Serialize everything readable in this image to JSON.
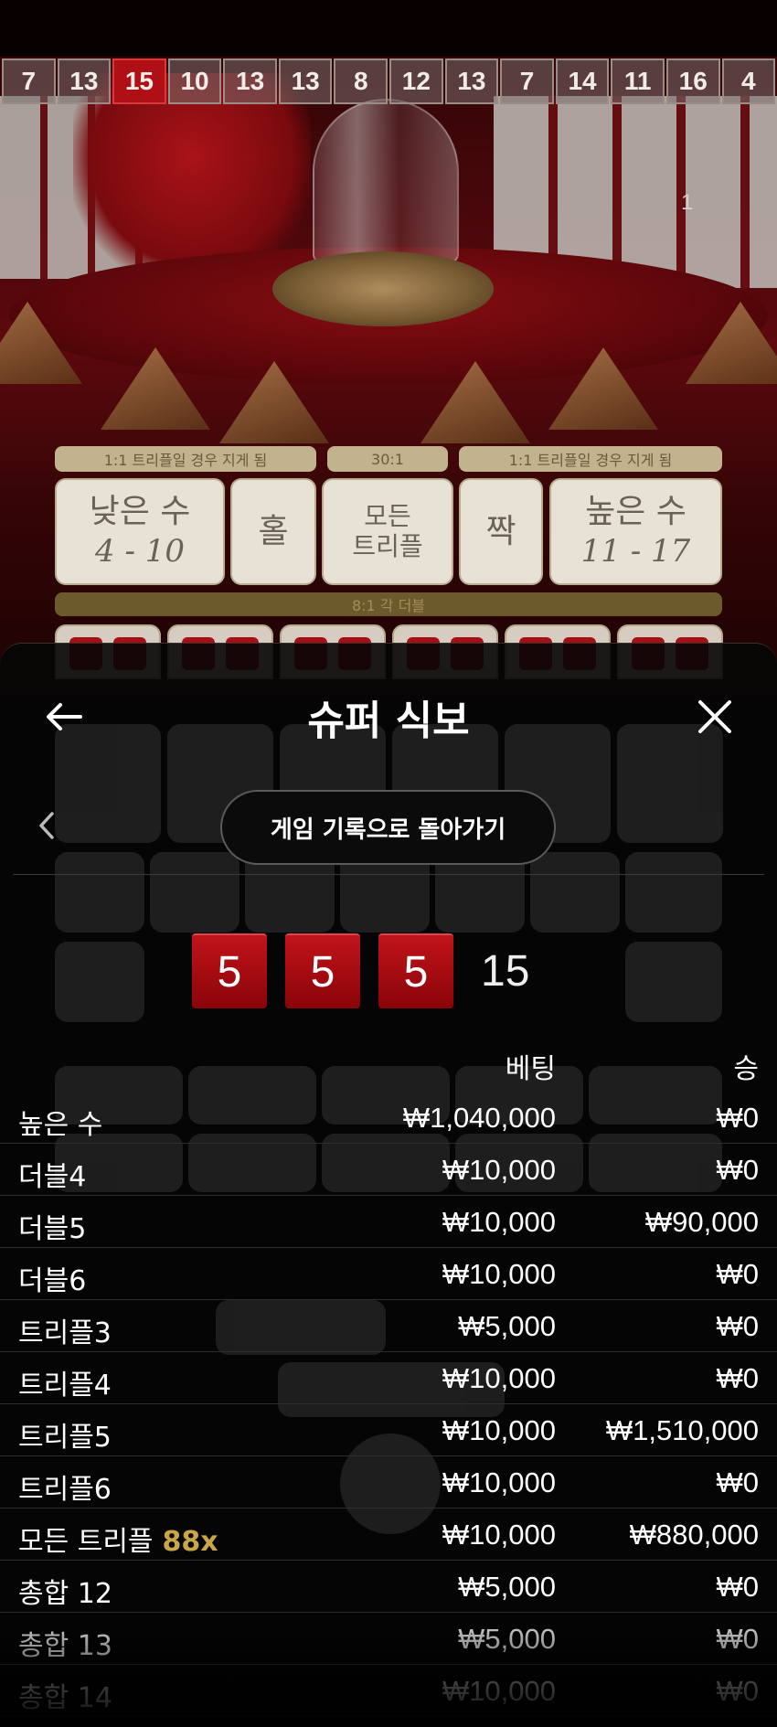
{
  "history_strip": [
    "7",
    "13",
    "15",
    "10",
    "13",
    "13",
    "8",
    "12",
    "13",
    "7",
    "14",
    "11",
    "16",
    "4"
  ],
  "history_highlight_index": 2,
  "round_counter": "1",
  "board": {
    "pay_left": "1:1 트리플일 경우 지게 됨",
    "pay_mid": "30:1",
    "pay_right": "1:1 트리플일 경우 지게 됨",
    "low_label": "낮은 수",
    "low_range": "4 - 10",
    "odd_label": "홀",
    "any_triple_line1": "모든",
    "any_triple_line2": "트리플",
    "even_label": "짝",
    "high_label": "높은 수",
    "high_range": "11 - 17",
    "doubles_strip": "8:1 각 더블"
  },
  "panel": {
    "title": "슈퍼 식보",
    "back_button_label": "게임 기록으로 돌아가기",
    "dice": [
      "5",
      "5",
      "5"
    ],
    "sum": "15",
    "col_bet": "베팅",
    "col_win": "승",
    "rows": [
      {
        "name": "높은 수",
        "mult": "",
        "bet": "₩1,040,000",
        "win": "₩0"
      },
      {
        "name": "더블4",
        "mult": "",
        "bet": "₩10,000",
        "win": "₩0"
      },
      {
        "name": "더블5",
        "mult": "",
        "bet": "₩10,000",
        "win": "₩90,000"
      },
      {
        "name": "더블6",
        "mult": "",
        "bet": "₩10,000",
        "win": "₩0"
      },
      {
        "name": "트리플3",
        "mult": "",
        "bet": "₩5,000",
        "win": "₩0"
      },
      {
        "name": "트리플4",
        "mult": "",
        "bet": "₩10,000",
        "win": "₩0"
      },
      {
        "name": "트리플5",
        "mult": "",
        "bet": "₩10,000",
        "win": "₩1,510,000"
      },
      {
        "name": "트리플6",
        "mult": "",
        "bet": "₩10,000",
        "win": "₩0"
      },
      {
        "name": "모든 트리플",
        "mult": "88x",
        "bet": "₩10,000",
        "win": "₩880,000"
      },
      {
        "name": "총합 12",
        "mult": "",
        "bet": "₩5,000",
        "win": "₩0"
      },
      {
        "name": "총합 13",
        "mult": "",
        "bet": "₩5,000",
        "win": "₩0"
      },
      {
        "name": "총합 14",
        "mult": "",
        "bet": "₩10,000",
        "win": "₩0"
      }
    ]
  },
  "colors": {
    "accent_red": "#b10f16",
    "gold": "#c9a646",
    "panel_bg": "#060606"
  },
  "icons": {
    "back": "arrow-left-icon",
    "close": "close-icon",
    "prev": "chevron-left-icon"
  }
}
